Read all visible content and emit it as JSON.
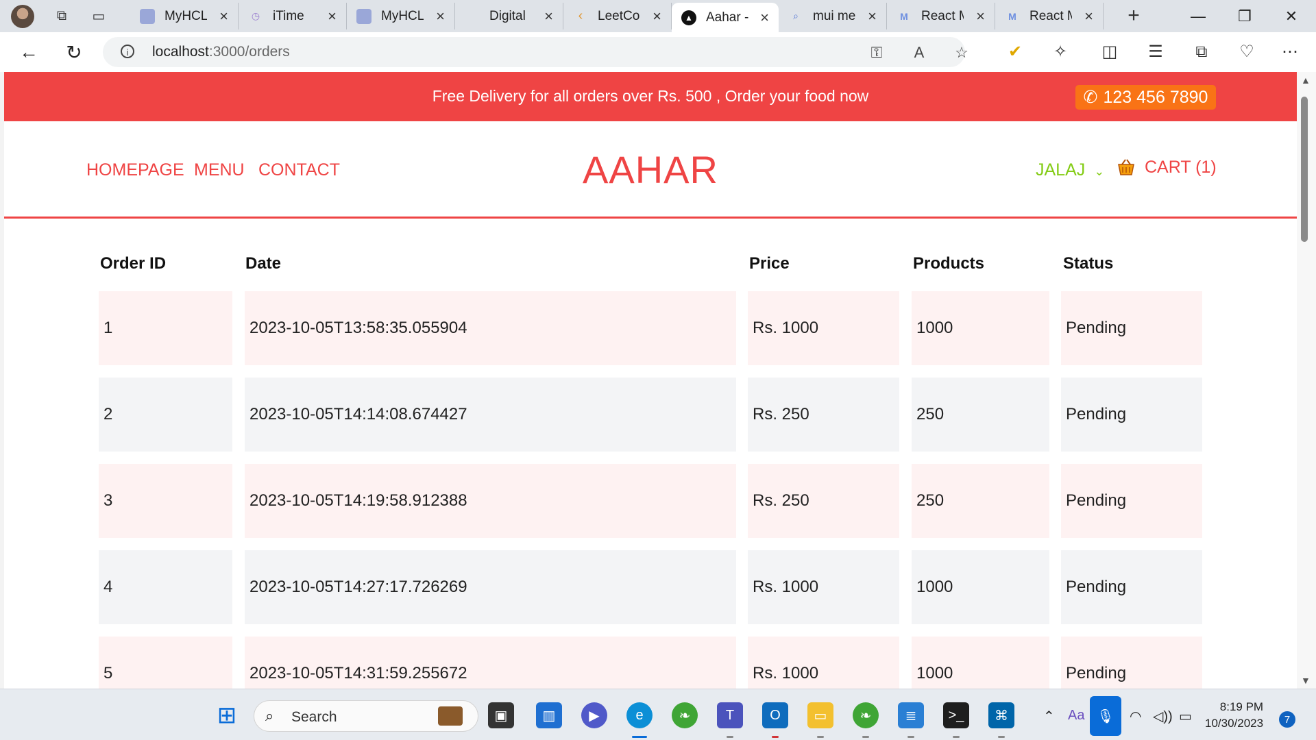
{
  "browser": {
    "tabs": [
      {
        "title": "MyHCL",
        "favicon": "myhcl-icon",
        "color": "#9aa7d8"
      },
      {
        "title": "iTime",
        "favicon": "clock-icon",
        "color": "#b59be0"
      },
      {
        "title": "MyHCL",
        "favicon": "myhcl-icon",
        "color": "#9aa7d8"
      },
      {
        "title": "Digital",
        "favicon": "blank-icon",
        "color": "#dfe3e8"
      },
      {
        "title": "LeetCo",
        "favicon": "leetcode-icon",
        "color": "#f0a040"
      },
      {
        "title": "Aahar -",
        "favicon": "react-app-icon",
        "color": "#111111"
      },
      {
        "title": "mui me",
        "favicon": "search-icon",
        "color": "#5b7bd6"
      },
      {
        "title": "React M",
        "favicon": "mui-icon",
        "color": "#6d8fe0"
      },
      {
        "title": "React M",
        "favicon": "mui-icon",
        "color": "#6d8fe0"
      }
    ],
    "active_tab_index": 5,
    "url_host": "localhost",
    "url_path": ":3000/orders"
  },
  "promo": {
    "text": "Free Delivery for all orders over Rs. 500 , Order your food now",
    "phone": "123 456 7890"
  },
  "nav": {
    "links": [
      "HOMEPAGE",
      "MENU",
      "CONTACT"
    ],
    "logo": "AAHAR",
    "user": "JALAJ",
    "cart_label": "CART (1)"
  },
  "orders": {
    "headers": [
      "Order ID",
      "Date",
      "Price",
      "Products",
      "Status"
    ],
    "rows": [
      {
        "id": "1",
        "date": "2023-10-05T13:58:35.055904",
        "price": "Rs. 1000",
        "products": "1000",
        "status": "Pending"
      },
      {
        "id": "2",
        "date": "2023-10-05T14:14:08.674427",
        "price": "Rs. 250",
        "products": "250",
        "status": "Pending"
      },
      {
        "id": "3",
        "date": "2023-10-05T14:19:58.912388",
        "price": "Rs. 250",
        "products": "250",
        "status": "Pending"
      },
      {
        "id": "4",
        "date": "2023-10-05T14:27:17.726269",
        "price": "Rs. 1000",
        "products": "1000",
        "status": "Pending"
      },
      {
        "id": "5",
        "date": "2023-10-05T14:31:59.255672",
        "price": "Rs. 1000",
        "products": "1000",
        "status": "Pending"
      }
    ]
  },
  "taskbar": {
    "search_label": "Search",
    "time": "8:19 PM",
    "date": "10/30/2023",
    "notification_count": "7"
  },
  "colors": {
    "brand_red": "#ef4444",
    "phone_orange": "#f97316",
    "user_green": "#84cc16",
    "row_pink": "#fef2f2",
    "row_gray": "#f3f4f6"
  }
}
